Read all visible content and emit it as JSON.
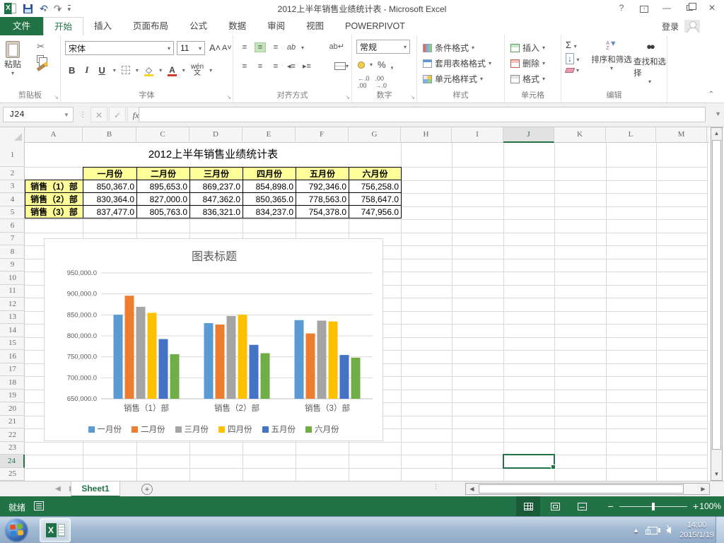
{
  "window": {
    "title": "2012上半年销售业绩统计表 - Microsoft Excel",
    "help": "?",
    "sign_in": "登录"
  },
  "ribbon_tabs": {
    "file": "文件",
    "items": [
      "开始",
      "插入",
      "页面布局",
      "公式",
      "数据",
      "审阅",
      "视图",
      "POWERPIVOT"
    ],
    "active": "开始"
  },
  "ribbon": {
    "clipboard": {
      "label": "剪贴板",
      "paste": "粘贴"
    },
    "font": {
      "label": "字体",
      "name": "宋体",
      "size": "11"
    },
    "alignment": {
      "label": "对齐方式"
    },
    "number": {
      "label": "数字",
      "format": "常规"
    },
    "styles": {
      "label": "样式",
      "items": [
        "条件格式",
        "套用表格格式",
        "单元格样式"
      ]
    },
    "cells": {
      "label": "单元格",
      "items": [
        "插入",
        "删除",
        "格式"
      ]
    },
    "editing": {
      "label": "编辑",
      "sort": "排序和筛选",
      "find": "查找和选择"
    }
  },
  "formula_bar": {
    "name_box": "J24",
    "value": ""
  },
  "sheet": {
    "columns": [
      "A",
      "B",
      "C",
      "D",
      "E",
      "F",
      "G",
      "H",
      "I",
      "J",
      "K",
      "L",
      "M"
    ],
    "row_count": 25,
    "selected": {
      "cell": "J24",
      "column": "J",
      "row": 24
    },
    "table": {
      "title": "2012上半年销售业绩统计表",
      "month_headers": [
        "一月份",
        "二月份",
        "三月份",
        "四月份",
        "五月份",
        "六月份"
      ],
      "rows": [
        {
          "label": "销售（1）部",
          "values": [
            "850,367.0",
            "895,653.0",
            "869,237.0",
            "854,898.0",
            "792,346.0",
            "756,258.0"
          ]
        },
        {
          "label": "销售（2）部",
          "values": [
            "830,364.0",
            "827,000.0",
            "847,362.0",
            "850,365.0",
            "778,563.0",
            "758,647.0"
          ]
        },
        {
          "label": "销售（3）部",
          "values": [
            "837,477.0",
            "805,763.0",
            "836,321.0",
            "834,237.0",
            "754,378.0",
            "747,956.0"
          ]
        }
      ]
    },
    "sheet_tabs": [
      "Sheet1"
    ]
  },
  "chart_data": {
    "type": "bar",
    "title": "图表标题",
    "categories": [
      "销售（1）部",
      "销售（2）部",
      "销售（3）部"
    ],
    "series": [
      {
        "name": "一月份",
        "color": "#5B9BD5",
        "values": [
          850367,
          830364,
          837477
        ]
      },
      {
        "name": "二月份",
        "color": "#ED7D31",
        "values": [
          895653,
          827000,
          805763
        ]
      },
      {
        "name": "三月份",
        "color": "#A5A5A5",
        "values": [
          869237,
          847362,
          836321
        ]
      },
      {
        "name": "四月份",
        "color": "#FFC000",
        "values": [
          854898,
          850365,
          834237
        ]
      },
      {
        "name": "五月份",
        "color": "#4472C4",
        "values": [
          792346,
          778563,
          754378
        ]
      },
      {
        "name": "六月份",
        "color": "#70AD47",
        "values": [
          756258,
          758647,
          747956
        ]
      }
    ],
    "ylim": [
      650000,
      950000
    ],
    "ytick_step": 50000,
    "grid": true,
    "legend_position": "bottom"
  },
  "status_bar": {
    "ready": "就绪",
    "zoom": "100%"
  },
  "taskbar": {
    "time": "14:00",
    "date": "2015/1/19"
  }
}
